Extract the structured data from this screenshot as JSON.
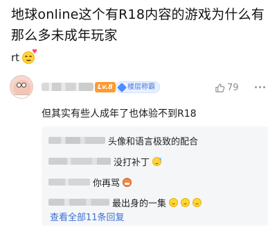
{
  "post": {
    "title": "地球online这个有R18内容的游戏为什么有那么多未成年玩家",
    "body": "rt"
  },
  "comment": {
    "level": "Lv.8",
    "badge": "楼层称霸",
    "likes": "79",
    "text": "但其实有些人成年了也体验不到R18"
  },
  "replies": [
    {
      "text": "头像和语言极致的配合"
    },
    {
      "text": "没打补丁"
    },
    {
      "text": "你再骂"
    },
    {
      "text": "最出身的一集"
    }
  ],
  "view_all": "查看全部11条回复",
  "colors": {
    "level_badge": "#ff9a2e",
    "badge_text": "#4b78d6",
    "link": "#3b6fd4",
    "reply_bg": "#f5f6f8"
  },
  "icons": [
    "smile-emoji-icon",
    "gem-icon",
    "thumb-up-icon",
    "more-icon",
    "sweat-emoji-icon",
    "angry-emoji-icon",
    "grin-emoji-icon"
  ]
}
